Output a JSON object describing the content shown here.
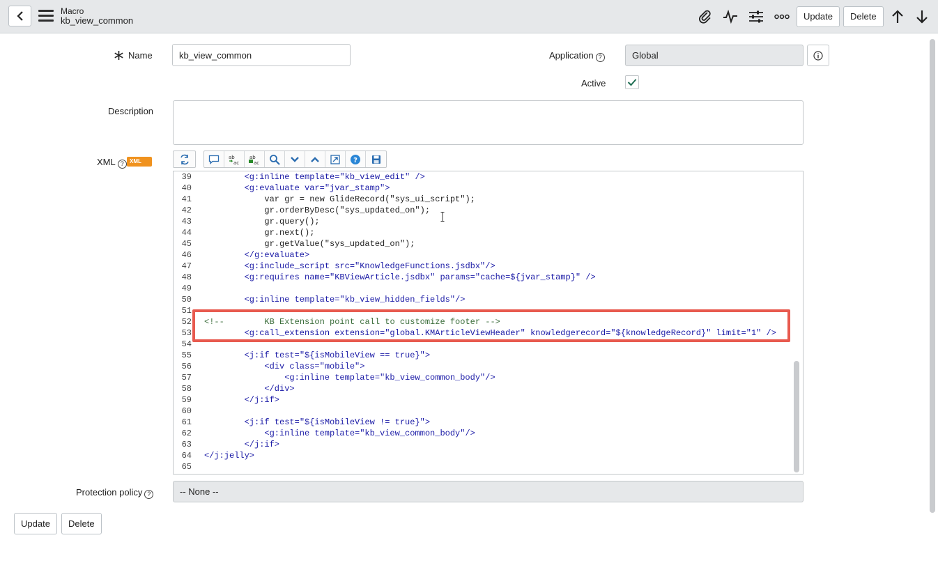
{
  "header": {
    "record_type": "Macro",
    "record_name": "kb_view_common",
    "update_label": "Update",
    "delete_label": "Delete"
  },
  "form": {
    "name_label": "Name",
    "name_value": "kb_view_common",
    "application_label": "Application",
    "application_value": "Global",
    "active_label": "Active",
    "active_checked": true,
    "description_label": "Description",
    "description_value": "",
    "xml_label": "XML",
    "xml_badge": "XML",
    "protection_label": "Protection policy",
    "protection_value": "-- None --"
  },
  "code_lines": [
    {
      "n": "39",
      "indent": 8,
      "parts": [
        [
          "tag",
          "<g:inline "
        ],
        [
          "attr",
          "template="
        ],
        [
          "str",
          "\"kb_view_edit\""
        ],
        [
          "tag",
          " />"
        ]
      ]
    },
    {
      "n": "40",
      "indent": 8,
      "parts": [
        [
          "tag",
          "<g:evaluate "
        ],
        [
          "attr",
          "var="
        ],
        [
          "str",
          "\"jvar_stamp\""
        ],
        [
          "tag",
          ">"
        ]
      ]
    },
    {
      "n": "41",
      "indent": 12,
      "parts": [
        [
          "plain",
          "var gr = new GlideRecord(\"sys_ui_script\");"
        ]
      ]
    },
    {
      "n": "42",
      "indent": 12,
      "parts": [
        [
          "plain",
          "gr.orderByDesc(\"sys_updated_on\");"
        ]
      ]
    },
    {
      "n": "43",
      "indent": 12,
      "parts": [
        [
          "plain",
          "gr.query();"
        ]
      ]
    },
    {
      "n": "44",
      "indent": 12,
      "parts": [
        [
          "plain",
          "gr.next();"
        ]
      ]
    },
    {
      "n": "45",
      "indent": 12,
      "parts": [
        [
          "plain",
          "gr.getValue(\"sys_updated_on\");"
        ]
      ]
    },
    {
      "n": "46",
      "indent": 8,
      "parts": [
        [
          "tag",
          "</g:evaluate>"
        ]
      ]
    },
    {
      "n": "47",
      "indent": 8,
      "parts": [
        [
          "tag",
          "<g:include_script "
        ],
        [
          "attr",
          "src="
        ],
        [
          "str",
          "\"KnowledgeFunctions.jsdbx\""
        ],
        [
          "tag",
          "/>"
        ]
      ]
    },
    {
      "n": "48",
      "indent": 8,
      "parts": [
        [
          "tag",
          "<g:requires "
        ],
        [
          "attr",
          "name="
        ],
        [
          "str",
          "\"KBViewArticle.jsdbx\""
        ],
        [
          "attr",
          " params="
        ],
        [
          "str",
          "\"cache=${jvar_stamp}\""
        ],
        [
          "tag",
          " />"
        ]
      ]
    },
    {
      "n": "49",
      "indent": 0,
      "parts": []
    },
    {
      "n": "50",
      "indent": 8,
      "parts": [
        [
          "tag",
          "<g:inline "
        ],
        [
          "attr",
          "template="
        ],
        [
          "str",
          "\"kb_view_hidden_fields\""
        ],
        [
          "tag",
          "/>"
        ]
      ]
    },
    {
      "n": "51",
      "indent": 0,
      "parts": []
    },
    {
      "n": "52",
      "indent": 0,
      "parts": [
        [
          "com",
          "<!--        KB Extension point call to customize footer -->"
        ]
      ]
    },
    {
      "n": "53",
      "indent": 8,
      "parts": [
        [
          "tag",
          "<g:call_extension "
        ],
        [
          "attr",
          "extension="
        ],
        [
          "str",
          "\"global.KMArticleViewHeader\""
        ],
        [
          "attr",
          " knowledgerecord="
        ],
        [
          "str",
          "\"${knowledgeRecord}\""
        ],
        [
          "attr",
          " limit="
        ],
        [
          "str",
          "\"1\""
        ],
        [
          "tag",
          " />"
        ]
      ]
    },
    {
      "n": "54",
      "indent": 0,
      "parts": []
    },
    {
      "n": "55",
      "indent": 8,
      "parts": [
        [
          "tag",
          "<j:if "
        ],
        [
          "attr",
          "test="
        ],
        [
          "str",
          "\"${isMobileView == true}\""
        ],
        [
          "tag",
          ">"
        ]
      ]
    },
    {
      "n": "56",
      "indent": 12,
      "parts": [
        [
          "tag",
          "<div "
        ],
        [
          "attr",
          "class="
        ],
        [
          "str",
          "\"mobile\""
        ],
        [
          "tag",
          ">"
        ]
      ]
    },
    {
      "n": "57",
      "indent": 16,
      "parts": [
        [
          "tag",
          "<g:inline "
        ],
        [
          "attr",
          "template="
        ],
        [
          "str",
          "\"kb_view_common_body\""
        ],
        [
          "tag",
          "/>"
        ]
      ]
    },
    {
      "n": "58",
      "indent": 12,
      "parts": [
        [
          "tag",
          "</div>"
        ]
      ]
    },
    {
      "n": "59",
      "indent": 8,
      "parts": [
        [
          "tag",
          "</j:if>"
        ]
      ]
    },
    {
      "n": "60",
      "indent": 0,
      "parts": []
    },
    {
      "n": "61",
      "indent": 8,
      "parts": [
        [
          "tag",
          "<j:if "
        ],
        [
          "attr",
          "test="
        ],
        [
          "str",
          "\"${isMobileView != true}\""
        ],
        [
          "tag",
          ">"
        ]
      ]
    },
    {
      "n": "62",
      "indent": 12,
      "parts": [
        [
          "tag",
          "<g:inline "
        ],
        [
          "attr",
          "template="
        ],
        [
          "str",
          "\"kb_view_common_body\""
        ],
        [
          "tag",
          "/>"
        ]
      ]
    },
    {
      "n": "63",
      "indent": 8,
      "parts": [
        [
          "tag",
          "</j:if>"
        ]
      ]
    },
    {
      "n": "64",
      "indent": 0,
      "parts": [
        [
          "tag",
          "</j:jelly>"
        ]
      ]
    },
    {
      "n": "65",
      "indent": 0,
      "parts": []
    }
  ],
  "footer": {
    "update_label": "Update",
    "delete_label": "Delete"
  },
  "colors": {
    "highlight_box": "#e85a4f",
    "xml_badge": "#f0921e"
  }
}
